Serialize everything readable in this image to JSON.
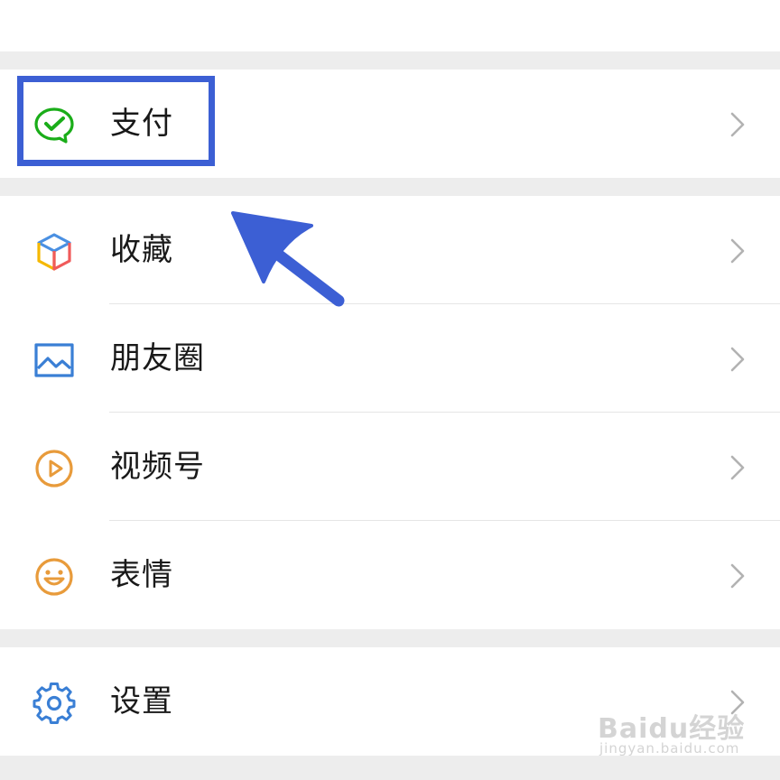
{
  "menu": {
    "pay": {
      "label": "支付",
      "icon": "wechat-pay-icon"
    },
    "favorites": {
      "label": "收藏",
      "icon": "cube-icon"
    },
    "moments": {
      "label": "朋友圈",
      "icon": "image-icon"
    },
    "channels": {
      "label": "视频号",
      "icon": "play-circle-icon"
    },
    "stickers": {
      "label": "表情",
      "icon": "smiley-icon"
    },
    "settings": {
      "label": "设置",
      "icon": "gear-icon"
    }
  },
  "annotation": {
    "highlight_color": "#3c5fd4"
  },
  "watermark": {
    "main": "Baidu经验",
    "sub": "jingyan.baidu.com"
  }
}
